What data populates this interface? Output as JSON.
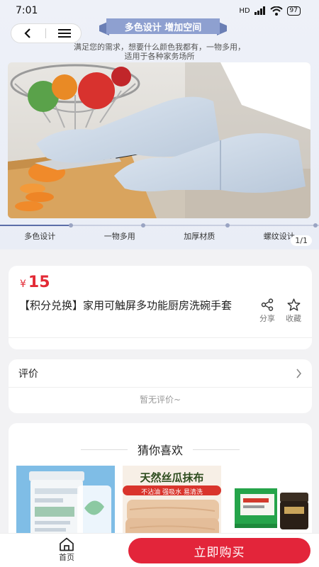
{
  "status": {
    "time": "7:01",
    "network": "HD",
    "battery": "97"
  },
  "hero": {
    "banner": "多色设计 增加空间",
    "subtitle_line1": "满足您的需求，想要什么颜色我都有，一物多用，",
    "subtitle_line2": "适用于各种家务场所",
    "features": [
      "多色设计",
      "一物多用",
      "加厚材质",
      "螺纹设计"
    ],
    "page_indicator": "1/1",
    "knife_brand": "hongda"
  },
  "product": {
    "currency": "¥",
    "price": "15",
    "title": "【积分兑换】家用可触屏多功能厨房洗碗手套",
    "share_label": "分享",
    "favorite_label": "收藏"
  },
  "reviews": {
    "title": "评价",
    "empty_text": "暂无评价~"
  },
  "recommendations": {
    "title": "猜你喜欢",
    "items": [
      {
        "label1": "天然丝瓜抹布",
        "label2": "不沾油 强吸水 易清洗"
      }
    ]
  },
  "bottom": {
    "home_label": "首页",
    "buy_label": "立即购买"
  },
  "colors": {
    "accent": "#e3253a",
    "price": "#e32a35",
    "banner": "#7f94c8"
  }
}
